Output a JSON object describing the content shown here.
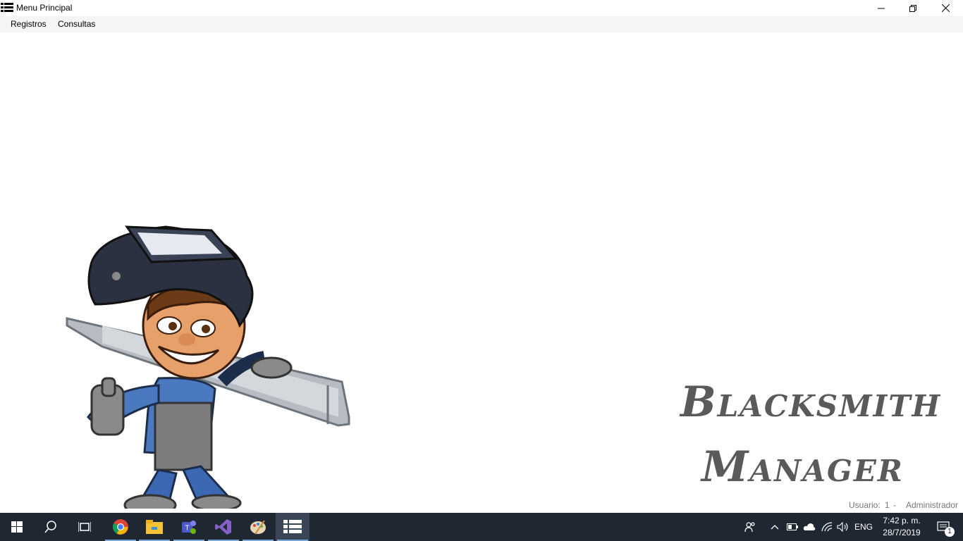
{
  "window": {
    "title": "Menu Principal",
    "controls": [
      "minimize",
      "restore",
      "close"
    ]
  },
  "menubar": {
    "items": [
      {
        "label": "Registros"
      },
      {
        "label": "Consultas"
      }
    ]
  },
  "main": {
    "brand_line1": "Blacksmith",
    "brand_line2": "Manager",
    "status": {
      "user_label": "Usuario:",
      "user_id": "1",
      "separator": "-",
      "user_name": "Administrador"
    }
  },
  "taskbar": {
    "apps": [
      "start-icon",
      "search-icon",
      "task-view-icon",
      "chrome-icon",
      "file-explorer-icon",
      "teams-icon",
      "visual-studio-icon",
      "paint-icon",
      "app-menu-icon"
    ],
    "tray": {
      "language": "ENG",
      "time": "7:42 p. m.",
      "date": "28/7/2019",
      "notifications": "1"
    }
  },
  "colors": {
    "taskbar_bg": "#1f2733",
    "menubar_bg": "#f5f5f5",
    "brand_text": "#5a5a5a",
    "status_text": "#777777"
  }
}
